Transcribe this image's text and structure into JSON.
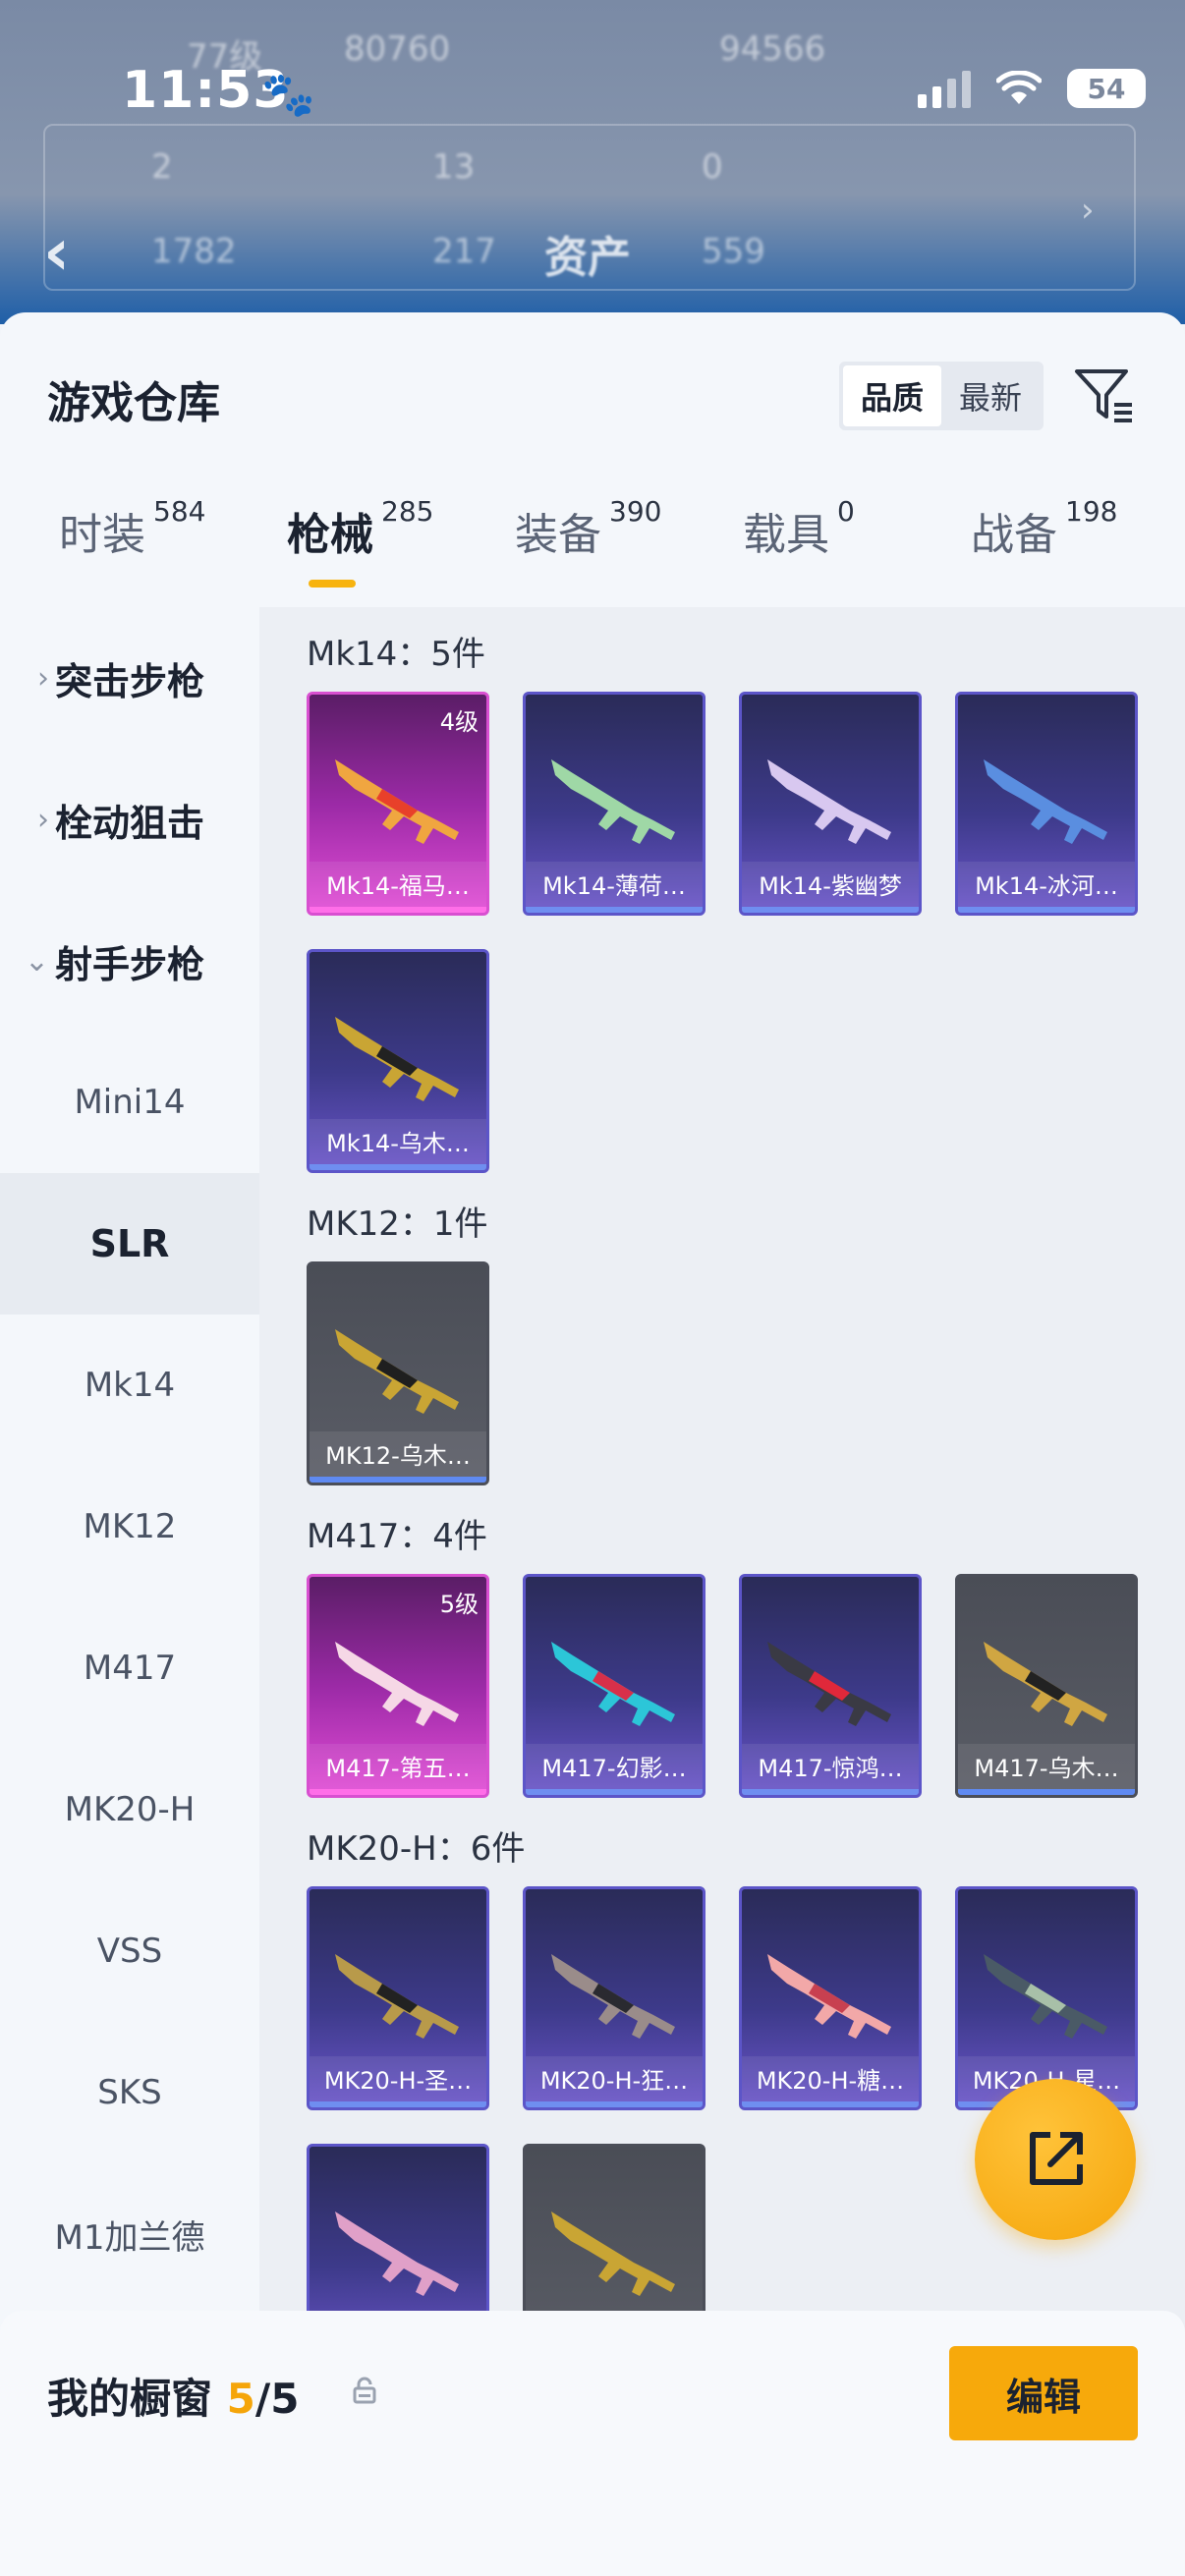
{
  "status": {
    "time": "11:53",
    "battery": "54"
  },
  "background": {
    "title": "资产",
    "row1": [
      "77级",
      "80760",
      "94566"
    ],
    "row2": [
      "2",
      "13",
      "0"
    ],
    "row3": [
      "1782",
      "217",
      "559"
    ]
  },
  "page": {
    "title": "游戏仓库"
  },
  "sort": {
    "options": [
      "品质",
      "最新"
    ],
    "selected": "品质"
  },
  "tabs": [
    {
      "label": "时装",
      "count": "584"
    },
    {
      "label": "枪械",
      "count": "285"
    },
    {
      "label": "装备",
      "count": "390"
    },
    {
      "label": "载具",
      "count": "0"
    },
    {
      "label": "战备",
      "count": "198"
    }
  ],
  "active_tab": "枪械",
  "sidebar": {
    "categories": [
      {
        "label": "突击步枪",
        "expanded": false
      },
      {
        "label": "栓动狙击",
        "expanded": false
      },
      {
        "label": "射手步枪",
        "expanded": true
      }
    ],
    "subcategories": [
      "Mini14",
      "SLR",
      "Mk14",
      "MK12",
      "M417",
      "MK20-H",
      "VSS",
      "SKS",
      "M1加兰德"
    ],
    "selected": "SLR"
  },
  "groups": [
    {
      "title": "Mk14：5件",
      "items": [
        {
          "name": "Mk14-福马…",
          "tier": "4级",
          "rarity": "gold"
        },
        {
          "name": "Mk14-薄荷…",
          "rarity": "epic"
        },
        {
          "name": "Mk14-紫幽梦",
          "rarity": "epic"
        },
        {
          "name": "Mk14-冰河…",
          "rarity": "epic"
        },
        {
          "name": "Mk14-乌木…",
          "rarity": "epic"
        }
      ]
    },
    {
      "title": "MK12：1件",
      "items": [
        {
          "name": "MK12-乌木…",
          "rarity": "grey"
        }
      ]
    },
    {
      "title": "M417：4件",
      "items": [
        {
          "name": "M417-第五…",
          "tier": "5级",
          "rarity": "gold"
        },
        {
          "name": "M417-幻影…",
          "rarity": "epic"
        },
        {
          "name": "M417-惊鸿…",
          "rarity": "epic"
        },
        {
          "name": "M417-乌木…",
          "rarity": "grey"
        }
      ]
    },
    {
      "title": "MK20-H：6件",
      "items": [
        {
          "name": "MK20-H-圣…",
          "rarity": "epic"
        },
        {
          "name": "MK20-H-狂…",
          "rarity": "epic"
        },
        {
          "name": "MK20-H-糖…",
          "rarity": "epic"
        },
        {
          "name": "MK20-H-星…",
          "rarity": "epic"
        },
        {
          "name": "",
          "rarity": "epic"
        },
        {
          "name": "",
          "rarity": "grey"
        }
      ]
    }
  ],
  "showcase": {
    "label": "我的橱窗",
    "current": "5",
    "total": "/5",
    "edit_label": "编辑"
  },
  "colors": {
    "accent": "#f7a90b",
    "epic": "#3d3a8a",
    "gold": "#d84fd0",
    "grey": "#5a5d66"
  }
}
